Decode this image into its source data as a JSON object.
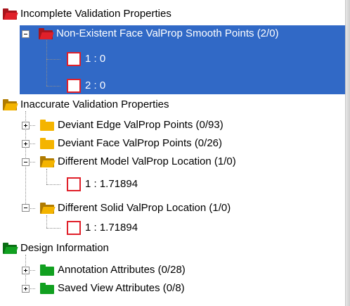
{
  "colors": {
    "selection": "#3169c6",
    "red_folder": "#e0202a",
    "yellow_folder": "#f4b400",
    "green_folder": "#11a020"
  },
  "tree": {
    "incomplete": {
      "label": "Incomplete Validation Properties",
      "icon": "red-open-folder-icon",
      "children": {
        "smooth_points": {
          "label": "Non-Existent Face ValProp Smooth Points (2/0)",
          "items": [
            "1 : 0",
            "2 : 0"
          ]
        }
      }
    },
    "inaccurate": {
      "label": "Inaccurate Validation Properties",
      "icon": "yellow-open-folder-icon",
      "children": {
        "edge_points": {
          "label": "Deviant Edge ValProp Points (0/93)"
        },
        "face_points": {
          "label": "Deviant Face ValProp Points (0/26)"
        },
        "model_location": {
          "label": "Different Model ValProp Location (1/0)",
          "items": [
            "1 : 1.71894"
          ]
        },
        "solid_location": {
          "label": "Different Solid ValProp Location (1/0)",
          "items": [
            "1 : 1.71894"
          ]
        }
      }
    },
    "design": {
      "label": "Design Information",
      "icon": "green-open-folder-icon",
      "children": {
        "annotation": {
          "label": "Annotation Attributes (0/28)"
        },
        "saved_view": {
          "label": "Saved View Attributes (0/8)"
        }
      }
    }
  }
}
